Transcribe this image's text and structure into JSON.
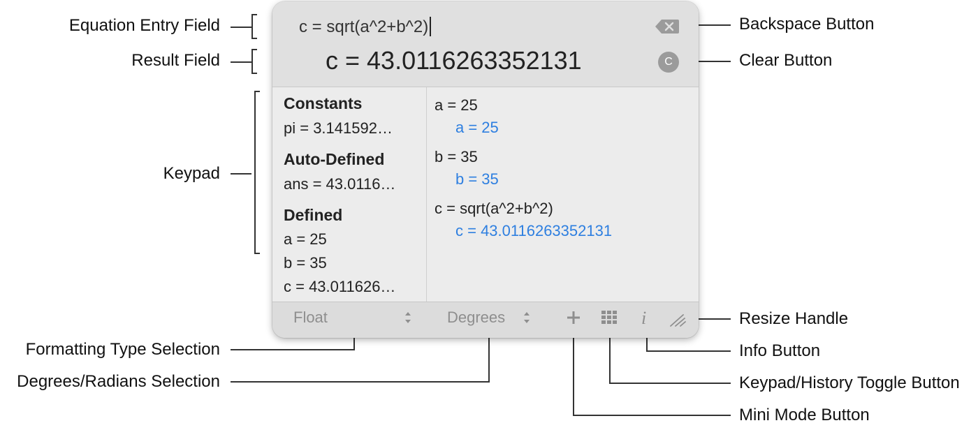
{
  "annotations": {
    "equation_entry_field": "Equation Entry Field",
    "result_field": "Result Field",
    "keypad": "Keypad",
    "formatting_type_selection": "Formatting Type Selection",
    "degrees_radians_selection": "Degrees/Radians Selection",
    "backspace_button": "Backspace Button",
    "clear_button": "Clear Button",
    "resize_handle": "Resize Handle",
    "info_button": "Info Button",
    "keypad_history_toggle_button": "Keypad/History Toggle Button",
    "mini_mode_button": "Mini Mode Button"
  },
  "calculator": {
    "equation": "c = sqrt(a^2+b^2)",
    "result": "c = 43.0116263352131",
    "clear_label": "C",
    "variables": {
      "constants_title": "Constants",
      "constants": [
        "pi = 3.141592…"
      ],
      "auto_defined_title": "Auto-Defined",
      "auto_defined": [
        "ans = 43.0116…"
      ],
      "defined_title": "Defined",
      "defined": [
        "a = 25",
        "b = 35",
        "c = 43.011626…"
      ]
    },
    "history": [
      {
        "input": "a = 25",
        "output": "a = 25"
      },
      {
        "input": "b = 35",
        "output": "b = 35"
      },
      {
        "input": "c = sqrt(a^2+b^2)",
        "output": "c = 43.0116263352131"
      }
    ],
    "format_select": "Float",
    "angle_select": "Degrees",
    "mini_mode_icon": "plus-icon",
    "toggle_icon": "keypad-grid-icon",
    "info_icon": "info-icon",
    "info_glyph": "i",
    "resize_icon": "resize-handle-icon"
  },
  "colors": {
    "history_output": "#2e7fe0"
  }
}
